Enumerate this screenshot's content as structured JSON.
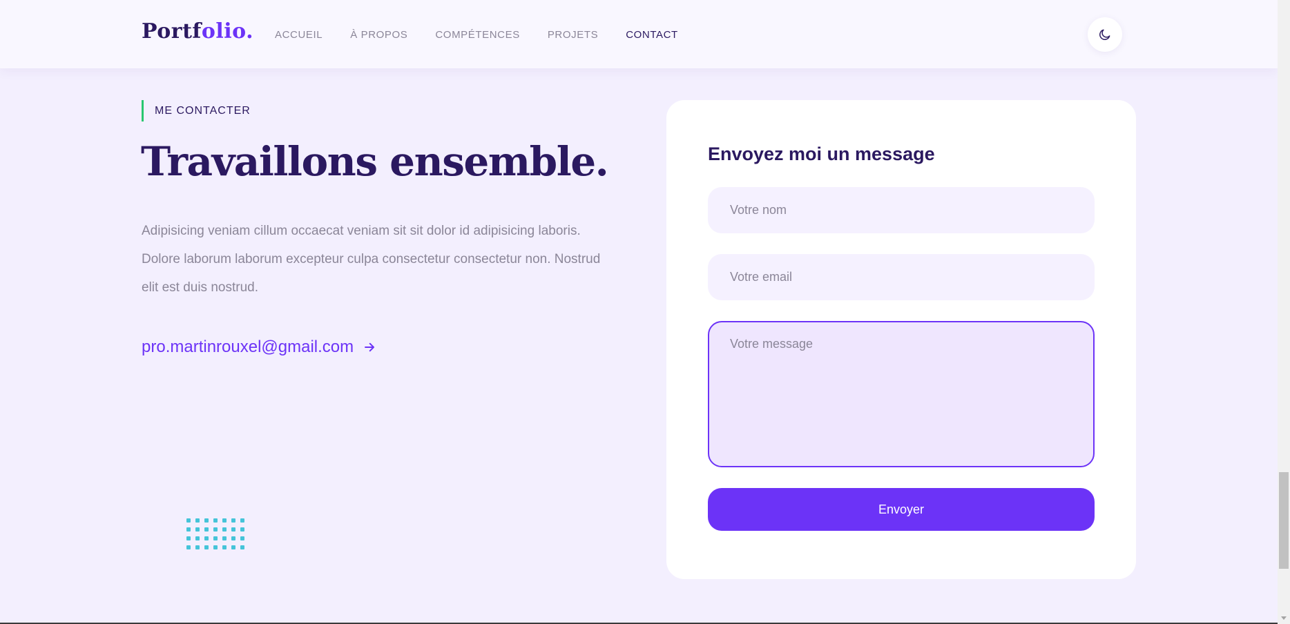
{
  "header": {
    "logo_main": "Portf",
    "logo_accent": "olio.",
    "nav": [
      "ACCUEIL",
      "À PROPOS",
      "COMPÉTENCES",
      "PROJETS",
      "CONTACT"
    ],
    "active_nav": "CONTACT",
    "theme_icon": "moon-icon"
  },
  "contact": {
    "eyebrow": "ME CONTACTER",
    "headline": "Travaillons ensemble.",
    "intro": "Adipisicing veniam cillum occaecat veniam sit sit dolor id adipisicing laboris. Dolore laborum laborum excepteur culpa consectetur consectetur non. Nostrud elit est duis nostrud.",
    "email": "pro.martinrouxel@gmail.com",
    "email_icon": "arrow-right-icon"
  },
  "form": {
    "title": "Envoyez moi un message",
    "name_placeholder": "Votre nom",
    "email_placeholder": "Votre email",
    "message_placeholder": "Votre message",
    "submit_label": "Envoyer"
  },
  "colors": {
    "brand": "#6c33f7",
    "heading": "#2b1960",
    "muted": "#8b8698",
    "eyebrow_bar": "#28c76f",
    "dots": "#45c4d9",
    "background": "#f3effe"
  }
}
